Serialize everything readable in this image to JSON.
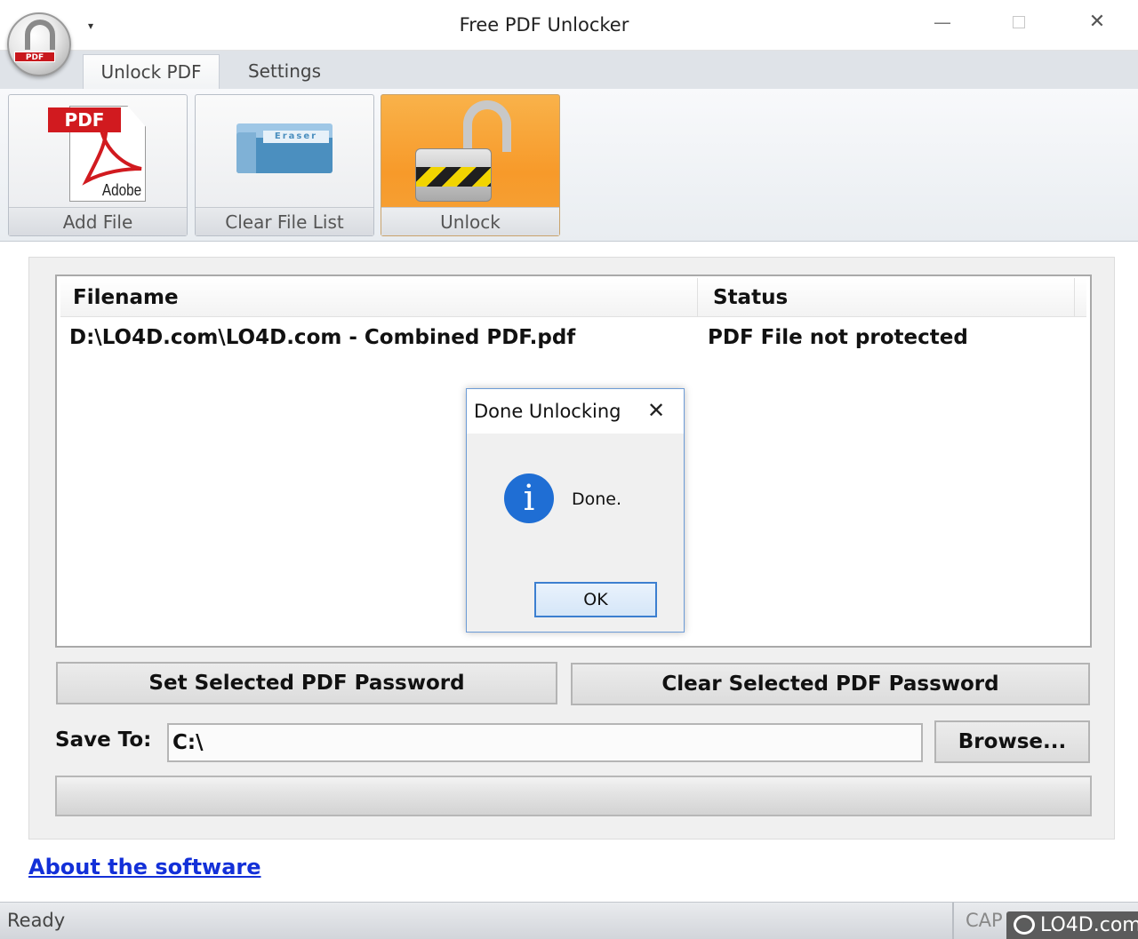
{
  "window": {
    "title": "Free PDF Unlocker",
    "app_badge": "PDF",
    "quick_access_glyph": "▾",
    "minimize_glyph": "—",
    "close_glyph": "✕"
  },
  "ribbon": {
    "tabs": [
      {
        "label": "Unlock PDF",
        "active": true
      },
      {
        "label": "Settings",
        "active": false
      }
    ],
    "buttons": {
      "add_file": {
        "label": "Add File",
        "icon": "pdf-file-icon",
        "icon_tag": "PDF",
        "icon_text": "Adobe"
      },
      "clear_file_list": {
        "label": "Clear File List",
        "icon": "eraser-icon",
        "icon_text": "Eraser"
      },
      "unlock": {
        "label": "Unlock",
        "icon": "padlock-open-icon",
        "highlighted": true
      }
    }
  },
  "file_list": {
    "columns": [
      "Filename",
      "Status"
    ],
    "rows": [
      {
        "filename": "D:\\LO4D.com\\LO4D.com - Combined PDF.pdf",
        "status": "PDF File not protected"
      }
    ]
  },
  "actions": {
    "set_password": "Set Selected PDF Password",
    "clear_password": "Clear Selected PDF Password"
  },
  "save_to": {
    "label": "Save To:",
    "value": "C:\\",
    "browse": "Browse..."
  },
  "progress": {
    "value": 0
  },
  "about_link": "About the software",
  "status_bar": {
    "text": "Ready",
    "indicator": "CAP"
  },
  "watermark": "LO4D.com",
  "dialog": {
    "title": "Done Unlocking",
    "close_glyph": "✕",
    "message": "Done.",
    "icon": "information-icon",
    "icon_glyph": "i",
    "ok": "OK"
  },
  "colors": {
    "accent_orange": "#f79a2a",
    "link_blue": "#1330d8",
    "info_blue": "#1f6ed4"
  }
}
